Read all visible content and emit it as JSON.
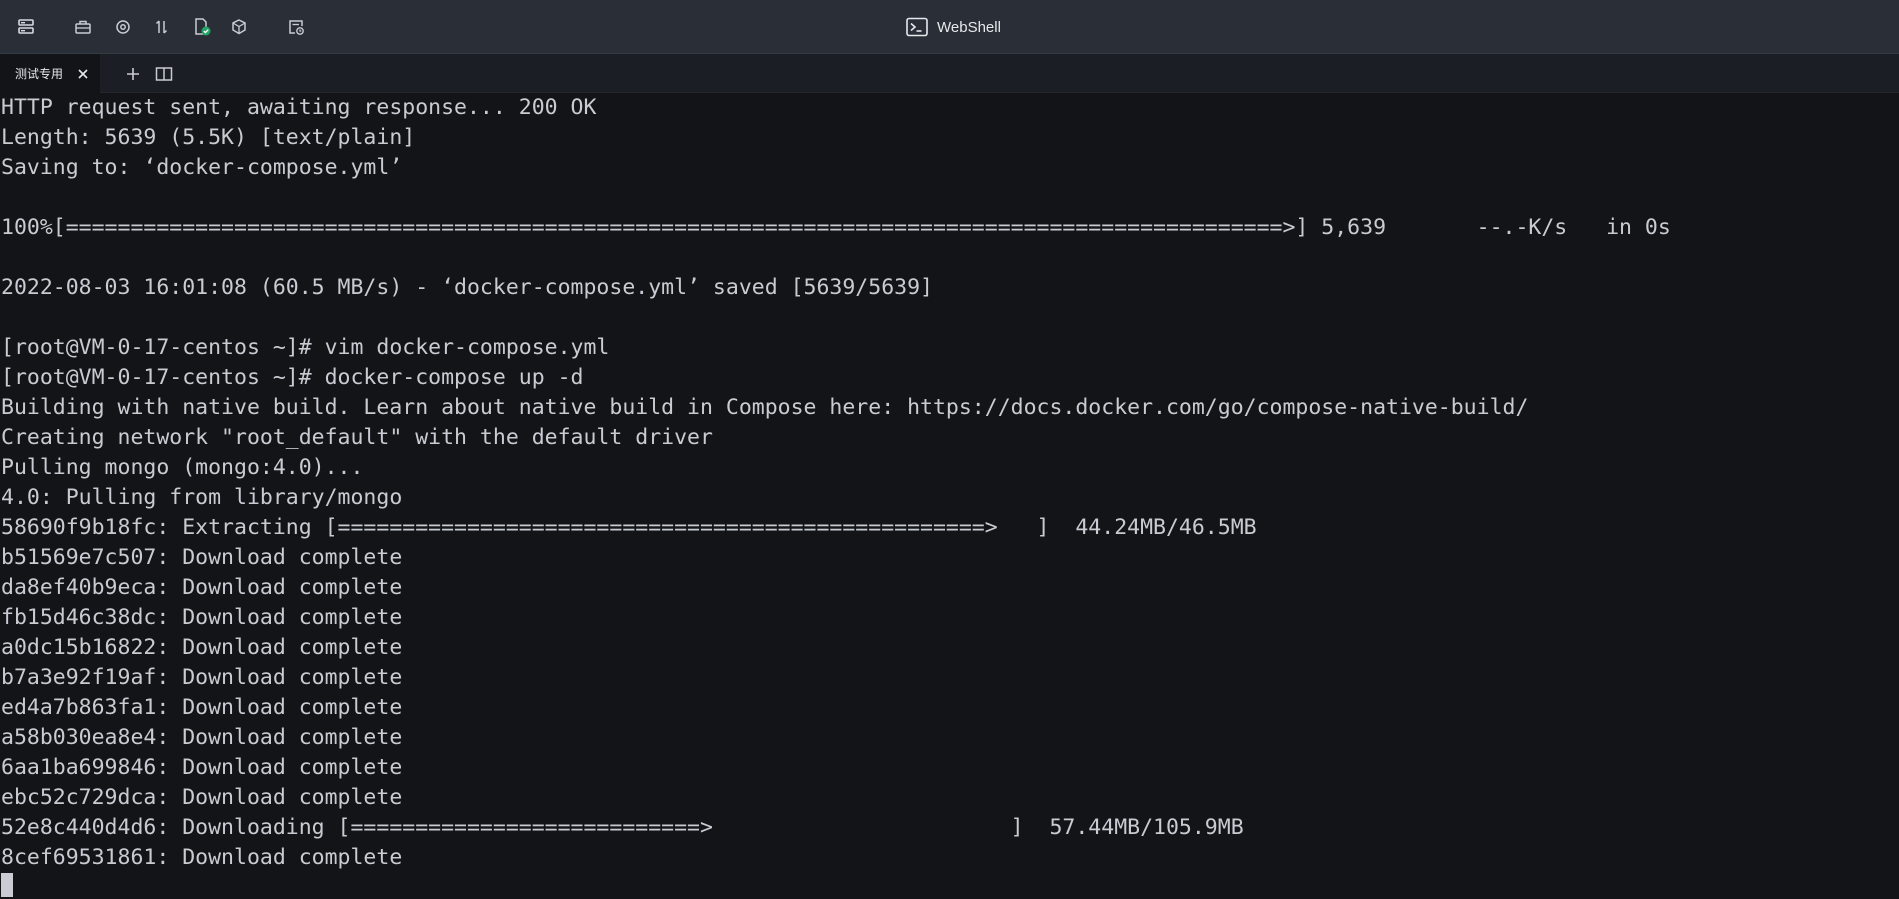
{
  "window": {
    "title": "WebShell",
    "toolbar_icons": [
      "server-list-icon",
      "toolbox-icon",
      "monitor-icon",
      "transfer-icon",
      "file-check-icon",
      "package-icon",
      "history-icon"
    ]
  },
  "tabs": [
    {
      "label": "测试专用",
      "active": true
    }
  ],
  "tab_actions": [
    "add-tab-icon",
    "split-view-icon"
  ],
  "terminal": {
    "lines": [
      "HTTP request sent, awaiting response... 200 OK",
      "Length: 5639 (5.5K) [text/plain]",
      "Saving to: ‘docker-compose.yml’",
      "",
      "100%[==============================================================================================>] 5,639       --.-K/s   in 0s",
      "",
      "2022-08-03 16:01:08 (60.5 MB/s) - ‘docker-compose.yml’ saved [5639/5639]",
      "",
      "[root@VM-0-17-centos ~]# vim docker-compose.yml",
      "[root@VM-0-17-centos ~]# docker-compose up -d",
      "Building with native build. Learn about native build in Compose here: https://docs.docker.com/go/compose-native-build/",
      "Creating network \"root_default\" with the default driver",
      "Pulling mongo (mongo:4.0)...",
      "4.0: Pulling from library/mongo",
      "58690f9b18fc: Extracting [==================================================>   ]  44.24MB/46.5MB",
      "b51569e7c507: Download complete",
      "da8ef40b9eca: Download complete",
      "fb15d46c38dc: Download complete",
      "a0dc15b16822: Download complete",
      "b7a3e92f19af: Download complete",
      "ed4a7b863fa1: Download complete",
      "a58b030ea8e4: Download complete",
      "6aa1ba699846: Download complete",
      "ebc52c729dca: Download complete",
      "52e8c440d4d6: Downloading [===========================>                       ]  57.44MB/105.9MB",
      "8cef69531861: Download complete"
    ],
    "colors": {
      "background": "#121418",
      "foreground": "#c8ccd2",
      "cursor": "#c9cdd3"
    }
  }
}
